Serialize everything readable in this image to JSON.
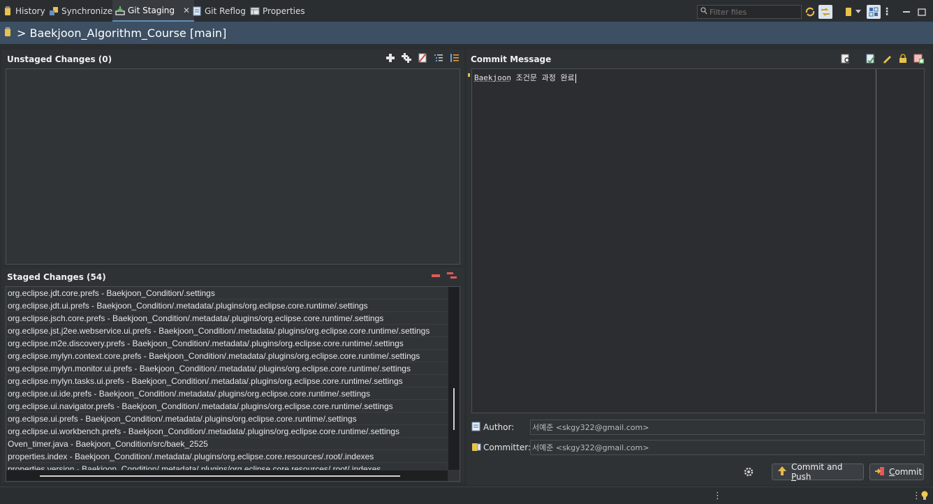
{
  "tabs": [
    {
      "label": "History",
      "icon": "history-icon"
    },
    {
      "label": "Synchronize",
      "icon": "synchronize-icon"
    },
    {
      "label": "Git Staging",
      "icon": "git-staging-icon",
      "active": true
    },
    {
      "label": "Git Reflog",
      "icon": "git-reflog-icon"
    },
    {
      "label": "Properties",
      "icon": "properties-icon"
    }
  ],
  "filter": {
    "placeholder": "Filter files"
  },
  "repo": {
    "title": "> Baekjoon_Algorithm_Course [main]"
  },
  "unstaged": {
    "title": "Unstaged Changes (0)"
  },
  "staged": {
    "title": "Staged Changes (54)",
    "items": [
      "org.eclipse.jdt.core.prefs - Baekjoon_Condition/.settings",
      "org.eclipse.jdt.ui.prefs - Baekjoon_Condition/.metadata/.plugins/org.eclipse.core.runtime/.settings",
      "org.eclipse.jsch.core.prefs - Baekjoon_Condition/.metadata/.plugins/org.eclipse.core.runtime/.settings",
      "org.eclipse.jst.j2ee.webservice.ui.prefs - Baekjoon_Condition/.metadata/.plugins/org.eclipse.core.runtime/.settings",
      "org.eclipse.m2e.discovery.prefs - Baekjoon_Condition/.metadata/.plugins/org.eclipse.core.runtime/.settings",
      "org.eclipse.mylyn.context.core.prefs - Baekjoon_Condition/.metadata/.plugins/org.eclipse.core.runtime/.settings",
      "org.eclipse.mylyn.monitor.ui.prefs - Baekjoon_Condition/.metadata/.plugins/org.eclipse.core.runtime/.settings",
      "org.eclipse.mylyn.tasks.ui.prefs - Baekjoon_Condition/.metadata/.plugins/org.eclipse.core.runtime/.settings",
      "org.eclipse.ui.ide.prefs - Baekjoon_Condition/.metadata/.plugins/org.eclipse.core.runtime/.settings",
      "org.eclipse.ui.navigator.prefs - Baekjoon_Condition/.metadata/.plugins/org.eclipse.core.runtime/.settings",
      "org.eclipse.ui.prefs - Baekjoon_Condition/.metadata/.plugins/org.eclipse.core.runtime/.settings",
      "org.eclipse.ui.workbench.prefs - Baekjoon_Condition/.metadata/.plugins/org.eclipse.core.runtime/.settings",
      "Oven_timer.java - Baekjoon_Condition/src/baek_2525",
      "properties.index - Baekjoon_Condition/.metadata/.plugins/org.eclipse.core.resources/.root/.indexes",
      "properties.version - Baekjoon_Condition/.metadata/.plugins/org.eclipse.core.resources/.root/.indexes"
    ]
  },
  "commit": {
    "title": "Commit Message",
    "message_word": "Baekjoon",
    "message_rest": " 조건문 과정 완료",
    "author_label": "Author:",
    "author_value": "서예준 <skgy322@gmail.com>",
    "committer_label": "Committer:",
    "committer_value": "서예준 <skgy322@gmail.com>",
    "commit_and_push_prefix": "Commit and ",
    "commit_and_push_key": "P",
    "commit_and_push_suffix": "ush",
    "commit_key": "C",
    "commit_suffix": "ommit"
  },
  "colors": {
    "accent": "#5f8fb6",
    "repo_bar": "#3c4f63",
    "minus_red": "#e05a5a"
  }
}
